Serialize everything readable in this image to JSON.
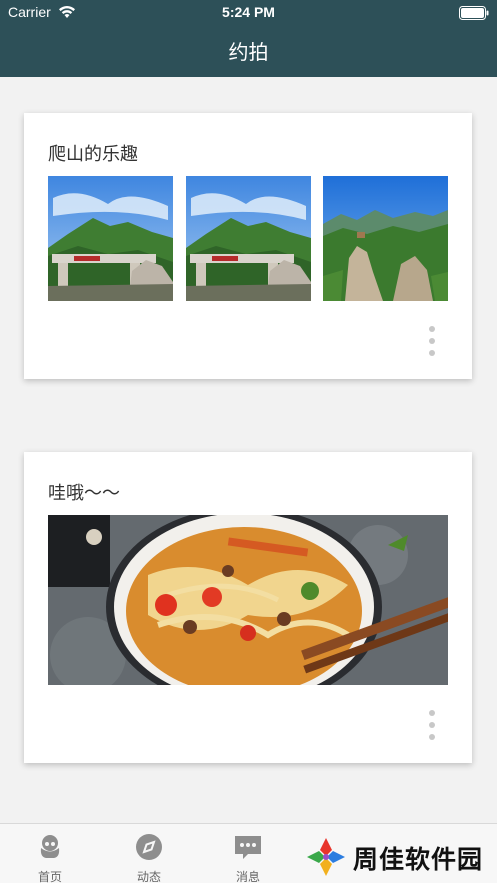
{
  "status_bar": {
    "carrier": "Carrier",
    "time": "5:24 PM"
  },
  "nav": {
    "title": "约拍"
  },
  "posts": [
    {
      "title": "爬山的乐趣",
      "photos": [
        "mountain-gate-photo",
        "mountain-gate-photo",
        "mountain-cliff-photo"
      ]
    },
    {
      "title": "哇哦～～",
      "photos": [
        "noodle-bowl-photo"
      ]
    }
  ],
  "tabbar": {
    "items": [
      {
        "label": "首页",
        "icon": "home-icon"
      },
      {
        "label": "动态",
        "icon": "compass-icon"
      },
      {
        "label": "消息",
        "icon": "message-icon"
      }
    ]
  },
  "watermark": {
    "text": "周佳软件园"
  },
  "colors": {
    "nav_bg": "#2d5058",
    "page_bg": "#f2f2f2",
    "card_bg": "#ffffff",
    "tab_icon": "#8e8e8e"
  }
}
